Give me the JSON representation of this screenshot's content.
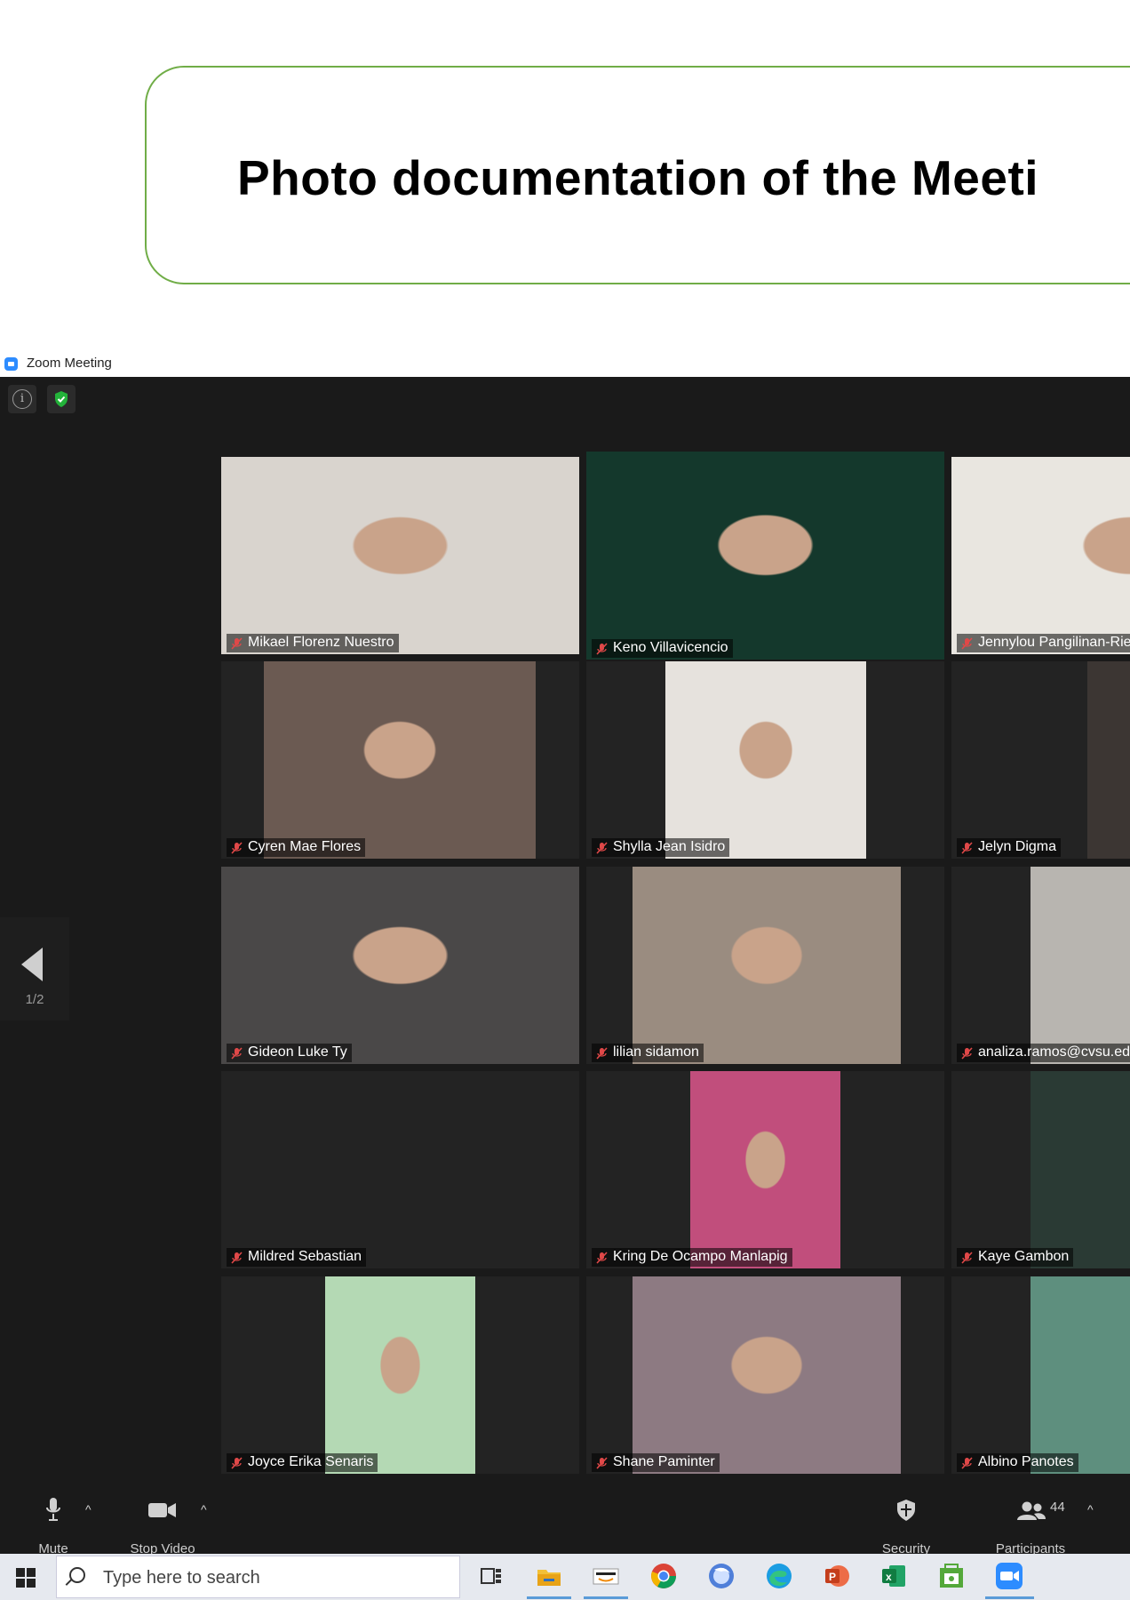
{
  "document": {
    "title": "Photo documentation of the Meeti"
  },
  "window": {
    "title": "Zoom Meeting"
  },
  "pager": {
    "current": "1/2"
  },
  "participants": [
    {
      "name": "Mikael Florenz Nuestro",
      "bg": "#d9d4ce"
    },
    {
      "name": "Keno Villavicencio",
      "bg": "#14382c"
    },
    {
      "name": "Jennylou Pangilinan-Riel",
      "bg": "#e9e6e0"
    },
    {
      "name": "Cyren Mae Flores",
      "bg": "#6b5a52"
    },
    {
      "name": "Shylla Jean Isidro",
      "bg": "#e6e2dd"
    },
    {
      "name": "Jelyn Digma",
      "bg": "#3c3633"
    },
    {
      "name": "Gideon Luke Ty",
      "bg": "#4a4848"
    },
    {
      "name": "lilian sidamon",
      "bg": "#9a8c80"
    },
    {
      "name": "analiza.ramos@cvsu.ed",
      "bg": "#b8b5b0"
    },
    {
      "name": "Mildred Sebastian",
      "bg": "#232323"
    },
    {
      "name": "Kring De Ocampo Manlapig",
      "bg": "#c14e7c"
    },
    {
      "name": "Kaye Gambon",
      "bg": "#2a3a34"
    },
    {
      "name": "Joyce Erika Senaris",
      "bg": "#b4d9b4"
    },
    {
      "name": "Shane Paminter",
      "bg": "#8d7a82"
    },
    {
      "name": "Albino Panotes",
      "bg": "#5e8f7e"
    }
  ],
  "controls": {
    "mute": "Mute",
    "stop_video": "Stop Video",
    "security": "Security",
    "participants": "Participants",
    "participants_count": "44"
  },
  "taskbar": {
    "search_placeholder": "Type here to search",
    "apps": [
      "task-view-icon",
      "file-explorer-icon",
      "amazon-icon",
      "chrome-icon",
      "firefox-icon",
      "edge-icon",
      "powerpoint-icon",
      "excel-icon",
      "store-icon",
      "zoom-icon"
    ]
  },
  "colors": {
    "active_speaker_border": "#c6e07a",
    "title_box_border": "#70ad47",
    "zoom_blue": "#2d8cff"
  }
}
